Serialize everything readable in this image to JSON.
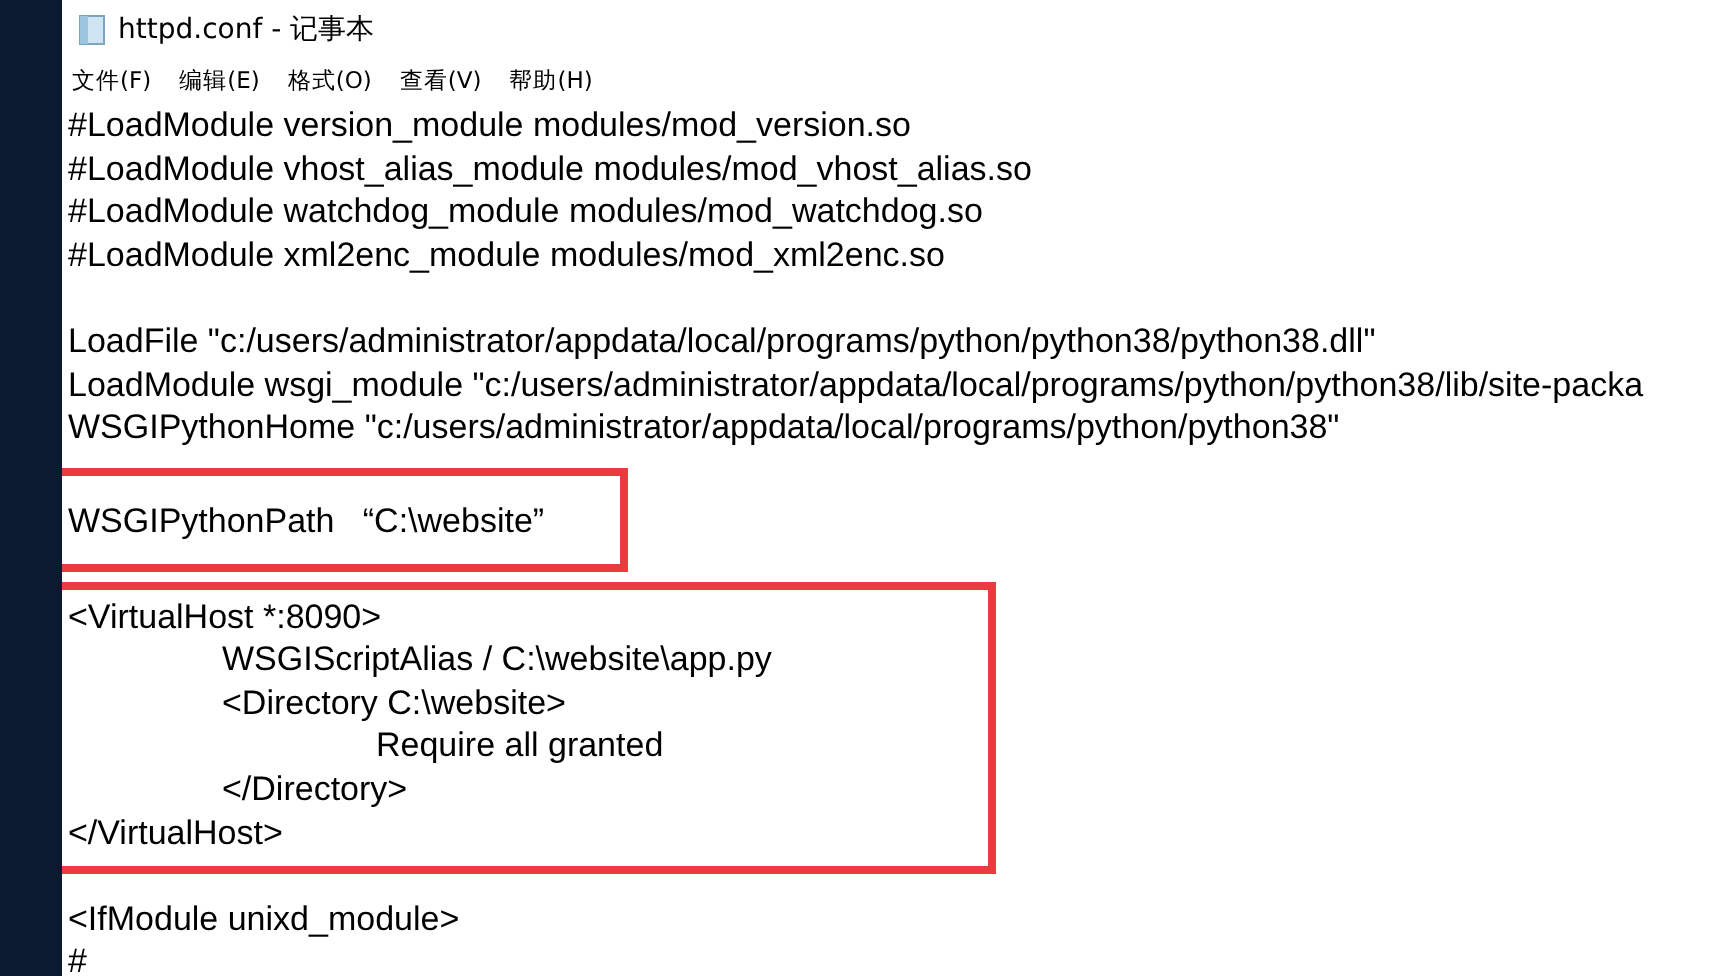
{
  "window": {
    "title": "httpd.conf - 记事本"
  },
  "menu": [
    "文件(F)",
    "编辑(E)",
    "格式(O)",
    "查看(V)",
    "帮助(H)"
  ],
  "editor": {
    "blocks": [
      {
        "boxed": false,
        "lines": [
          "#LoadModule version_module modules/mod_version.so",
          "#LoadModule vhost_alias_module modules/mod_vhost_alias.so",
          "#LoadModule watchdog_module modules/mod_watchdog.so",
          "#LoadModule xml2enc_module modules/mod_xml2enc.so"
        ]
      },
      {
        "boxed": false,
        "lines": [
          "LoadFile \"c:/users/administrator/appdata/local/programs/python/python38/python38.dll\"",
          "LoadModule wsgi_module \"c:/users/administrator/appdata/local/programs/python/python38/lib/site-packa",
          "WSGIPythonHome \"c:/users/administrator/appdata/local/programs/python/python38\""
        ]
      },
      {
        "boxed": true,
        "lines": [
          "WSGIPythonPath   “C:\\website”"
        ]
      },
      {
        "boxed": true,
        "lines": [
          "<VirtualHost *:8090>",
          "\tWSGIScriptAlias / C:\\website\\app.py",
          "\t<Directory C:\\website>",
          "\t\tRequire all granted",
          "\t</Directory>",
          "</VirtualHost>"
        ]
      },
      {
        "boxed": false,
        "lines": [
          "<IfModule unixd_module>",
          "#"
        ]
      }
    ]
  }
}
